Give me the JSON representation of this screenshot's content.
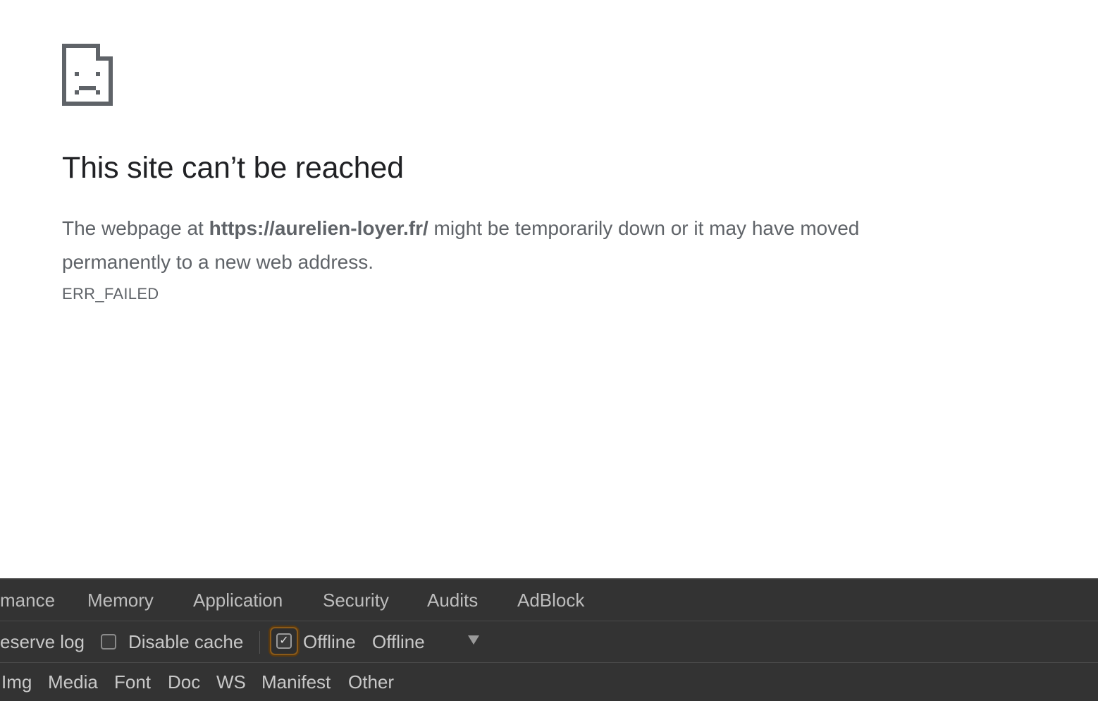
{
  "error": {
    "title": "This site can’t be reached",
    "message_prefix": "The webpage at ",
    "url": "https://aurelien-loyer.fr/",
    "message_suffix": " might be temporarily down or it may have moved permanently to a new web address.",
    "code": "ERR_FAILED",
    "icon": "sad-page-icon"
  },
  "devtools": {
    "tabs": [
      {
        "label": "mance"
      },
      {
        "label": "Memory"
      },
      {
        "label": "Application"
      },
      {
        "label": "Security"
      },
      {
        "label": "Audits"
      },
      {
        "label": "AdBlock"
      }
    ],
    "toolbar": {
      "preserve_log_label": "eserve log",
      "disable_cache_label": "Disable cache",
      "offline_label": "Offline",
      "throttle_value": "Offline"
    },
    "filters": [
      {
        "label": "Img"
      },
      {
        "label": "Media"
      },
      {
        "label": "Font"
      },
      {
        "label": "Doc"
      },
      {
        "label": "WS"
      },
      {
        "label": "Manifest"
      },
      {
        "label": "Other"
      }
    ]
  }
}
